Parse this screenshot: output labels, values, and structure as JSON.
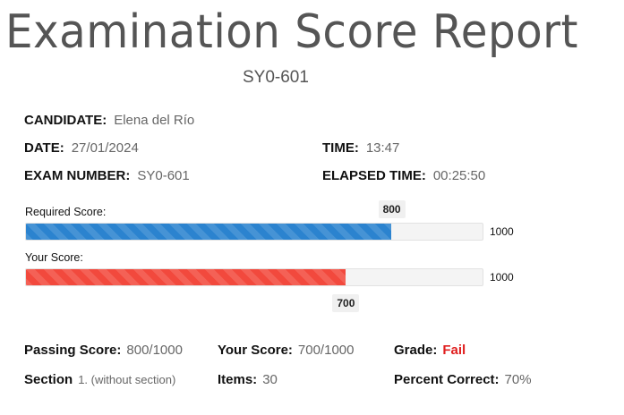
{
  "report": {
    "title": "Examination Score Report",
    "exam_code": "SY0-601"
  },
  "details": {
    "candidate_label": "CANDIDATE:",
    "candidate_value": "Elena del Río",
    "date_label": "DATE:",
    "date_value": "27/01/2024",
    "time_label": "TIME:",
    "time_value": "13:47",
    "exam_number_label": "EXAM NUMBER:",
    "exam_number_value": "SY0-601",
    "elapsed_label": "ELAPSED TIME:",
    "elapsed_value": "00:25:50"
  },
  "scores": {
    "required_label": "Required Score:",
    "required_value": "800",
    "required_max": "1000",
    "required_fraction": 0.8,
    "your_label": "Your Score:",
    "your_value": "700",
    "your_max": "1000",
    "your_fraction": 0.7,
    "colors": {
      "required_bar": "#2b83cf",
      "your_bar": "#f2493d",
      "fail_text": "#e02020"
    }
  },
  "summary": {
    "passing_label": "Passing Score:",
    "passing_value": "800/1000",
    "your_score_label": "Your Score:",
    "your_score_value": "700/1000",
    "grade_label": "Grade:",
    "grade_value": "Fail",
    "section_label": "Section",
    "section_value": "1. (without section)",
    "items_label": "Items:",
    "items_value": "30",
    "percent_label": "Percent Correct:",
    "percent_value": "70%"
  }
}
